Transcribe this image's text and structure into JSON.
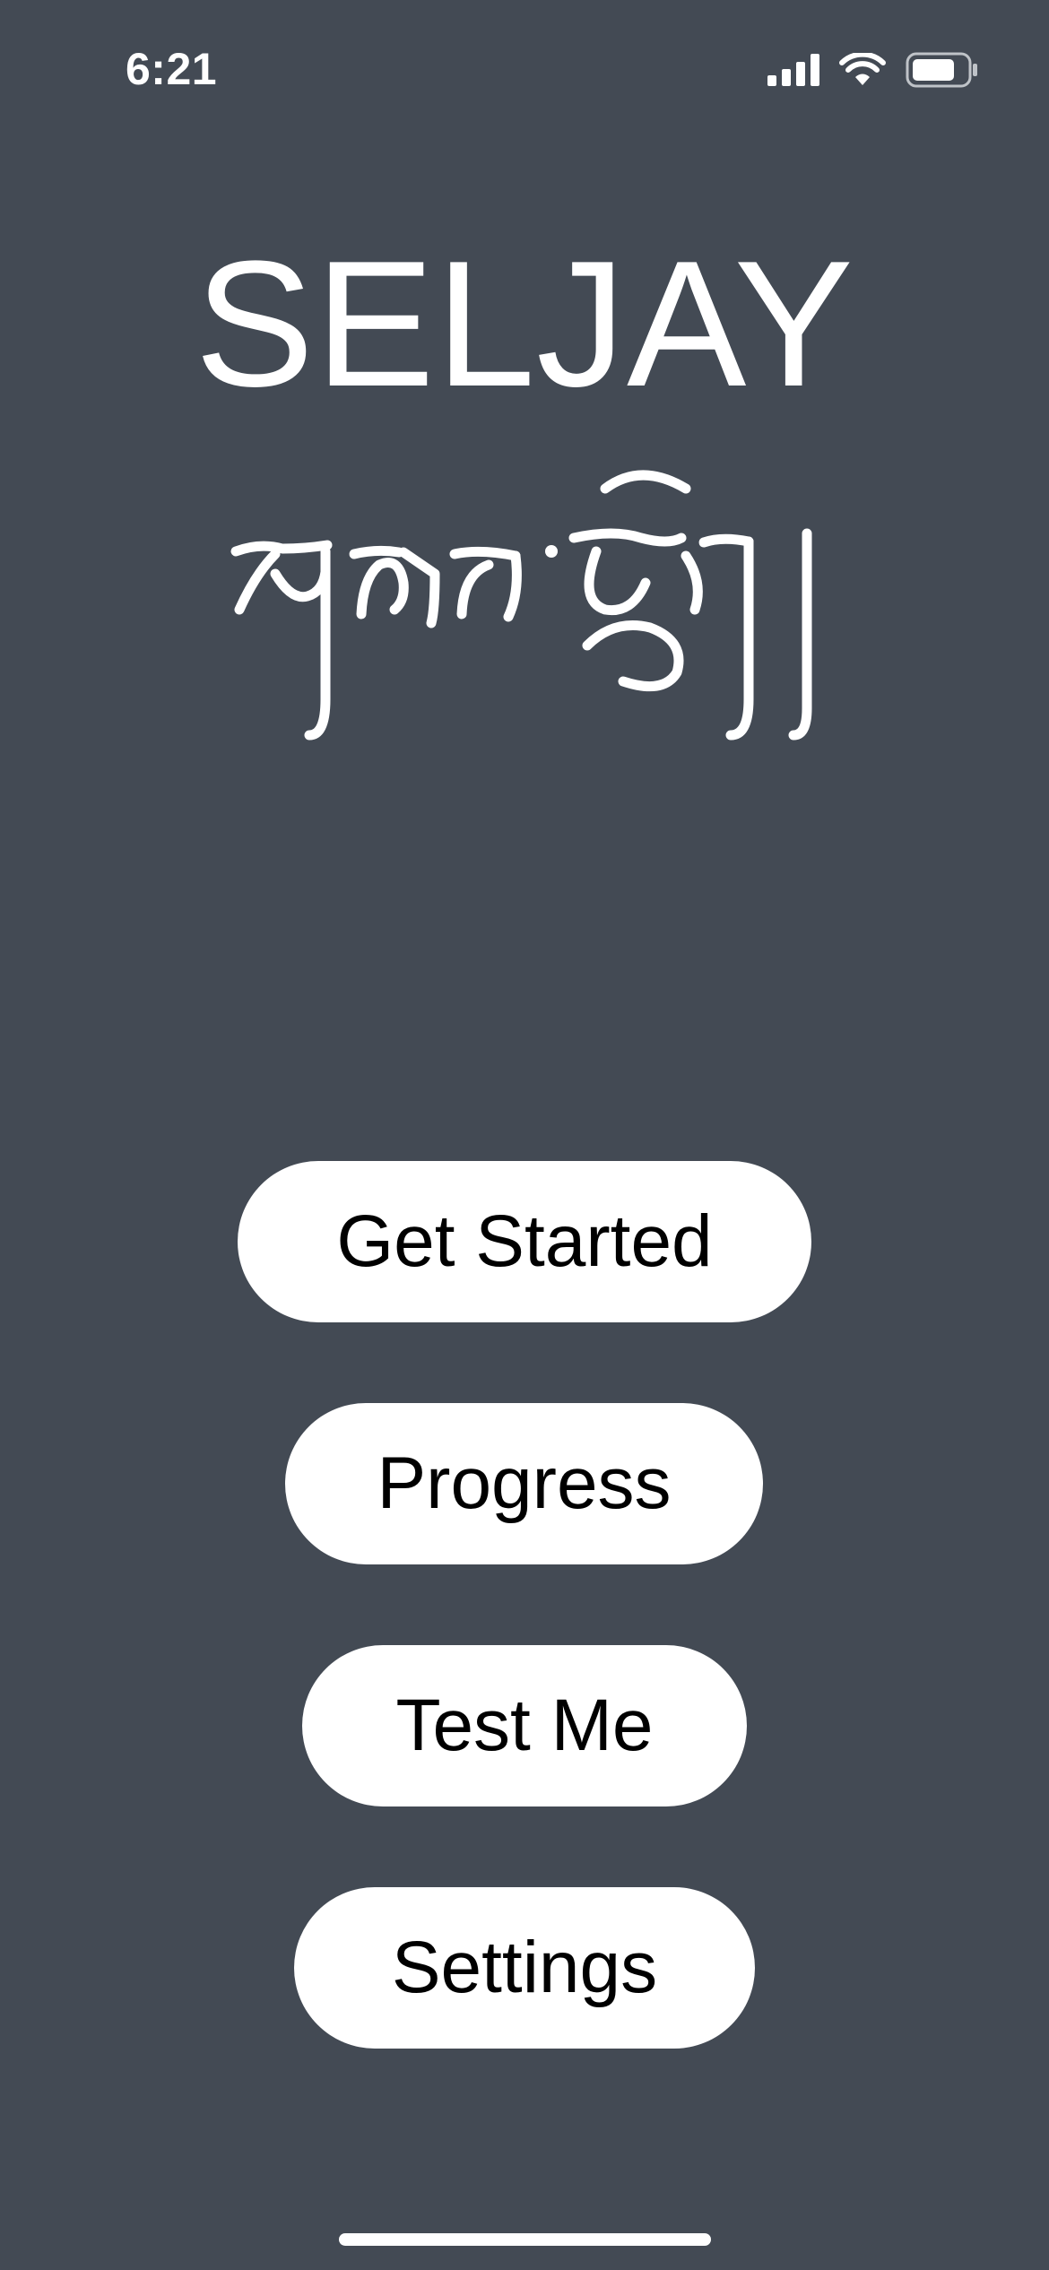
{
  "status_bar": {
    "time": "6:21",
    "icons": [
      "cellular-signal-icon",
      "wifi-icon",
      "battery-icon"
    ]
  },
  "header": {
    "title": "SELJAY",
    "tibetan_logo_text": "གསལ་བྱེད།"
  },
  "menu": {
    "get_started": "Get Started",
    "progress": "Progress",
    "test_me": "Test Me",
    "settings": "Settings"
  },
  "colors": {
    "background": "#434a54",
    "button_background": "#ffffff",
    "button_text": "#000000",
    "title_text": "#ffffff"
  }
}
